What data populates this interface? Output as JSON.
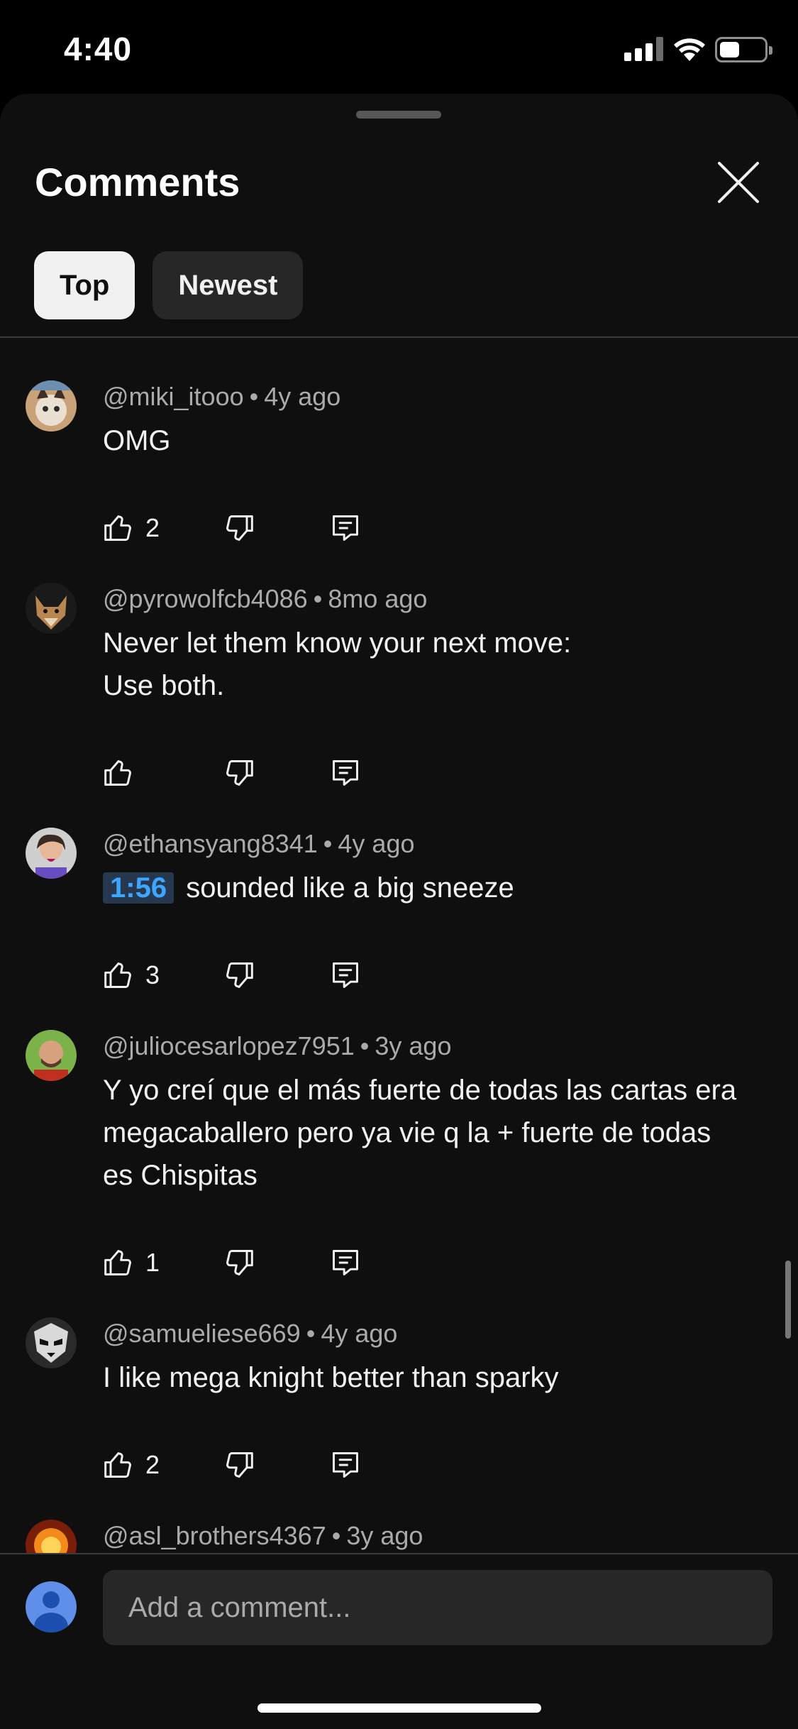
{
  "status_bar": {
    "time": "4:40",
    "icons": [
      "cellular-signal-icon",
      "wifi-icon",
      "battery-icon"
    ],
    "battery_level": 0.45
  },
  "sheet": {
    "title": "Comments",
    "close_icon": "close-icon",
    "tabs": [
      {
        "label": "Top",
        "active": true
      },
      {
        "label": "Newest",
        "active": false
      }
    ]
  },
  "comments": [
    {
      "author": "@miki_itooo",
      "age": "4y ago",
      "timestamp": "",
      "text": "OMG",
      "likes": "2",
      "avatar": "cat-photo-avatar"
    },
    {
      "author": "@pyrowolfcb4086",
      "age": "8mo ago",
      "timestamp": "",
      "text": "Never let them know your next move:\nUse both.",
      "likes": "",
      "avatar": "wolf-photo-avatar"
    },
    {
      "author": "@ethansyang8341",
      "age": "4y ago",
      "timestamp": "1:56",
      "text": "sounded like a big sneeze",
      "likes": "3",
      "avatar": "person-photo-avatar"
    },
    {
      "author": "@juliocesarlopez7951",
      "age": "3y ago",
      "timestamp": "",
      "text": "Y yo creí que el más fuerte de todas las cartas era megacaballero pero ya vie q la + fuerte de todas es Chispitas",
      "likes": "1",
      "avatar": "person-photo-avatar"
    },
    {
      "author": "@samueliese669",
      "age": "4y ago",
      "timestamp": "",
      "text": "I like mega knight better than sparky",
      "likes": "2",
      "avatar": "mask-logo-avatar"
    },
    {
      "author": "@asl_brothers4367",
      "age": "3y ago",
      "timestamp": "",
      "text": "",
      "likes": "",
      "avatar": "fire-photo-avatar"
    }
  ],
  "action_icons": {
    "like": "thumbs-up-icon",
    "dislike": "thumbs-down-icon",
    "reply": "reply-icon"
  },
  "composer": {
    "placeholder": "Add a comment...",
    "avatar": "default-user-avatar"
  },
  "colors": {
    "background": "#0f0f0f",
    "chip_active": "#f1f1f1",
    "chip_inactive": "#272727",
    "timestamp_link": "#3ea6ff",
    "secondary_text": "#aaaaaa"
  }
}
